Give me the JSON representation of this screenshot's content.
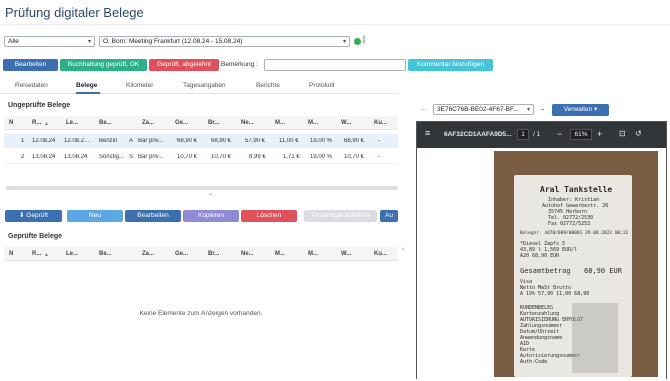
{
  "title": "Prüfung digitaler Belege",
  "filter": {
    "scope": "Alle",
    "trip": "O. Born: Meeting Frankfurt (12.08.24 - 15.08.24)"
  },
  "actions": {
    "edit": "Bearbeiten",
    "bookkeeping_ok": "Buchhaltung geprüft, OK",
    "rejected": "Geprüft, abgelehnt",
    "remark_label": "Bemerkung :",
    "remark_value": "",
    "add_comment": "Kommentar hinzufügen"
  },
  "tabs": [
    "Reisedaten",
    "Belege",
    "Kilometer",
    "Tagesangaben",
    "Berichte",
    "Protokoll"
  ],
  "unchecked": {
    "title": "Ungeprüfte Belege",
    "columns": [
      "N",
      "R...",
      "Le...",
      "Be...",
      "Za...",
      "Ge...",
      "Br...",
      "Ne...",
      "M...",
      "M...",
      "W...",
      "Ku..."
    ],
    "rows": [
      [
        "1",
        "12.08.24",
        "12.08.2...",
        "Benzin",
        "A",
        "Bar priv...",
        "68,90 €",
        "68,90 €",
        "57,90 €",
        "11,00 €",
        "19,00 %",
        "68,90 €",
        "-"
      ],
      [
        "2",
        "13.08.24",
        "13.08.24",
        "Sonstig...",
        "S",
        "Bar priv...",
        "10,70 €",
        "10,70 €",
        "8,99 €",
        "1,71 €",
        "19,00 %",
        "10,70 €",
        "-"
      ]
    ]
  },
  "buttons2": {
    "checked": "Geprüft",
    "new": "Neu",
    "edit": "Bearbeiten",
    "copy": "Kopieren",
    "delete": "Löschen",
    "split": "Prozentual aufteilen",
    "more": "Au"
  },
  "checked": {
    "title": "Geprüfte Belege",
    "columns": [
      "N",
      "R...",
      "Le...",
      "Be...",
      "Za...",
      "Ge...",
      "Br...",
      "Ne...",
      "M...",
      "M...",
      "W...",
      "Ku..."
    ],
    "empty": "Keine Elemente zum Anzeigen vorhanden."
  },
  "doc": {
    "id": "3E76C76B-BE02-4F67-BF...",
    "manage": "Verwalten",
    "file": "6AF32CD1AAFA9D5...",
    "page": "1",
    "pages": "/ 1",
    "zoom": "61%",
    "minus": "−",
    "plus": "+"
  },
  "receipt": {
    "header": "Aral Tankstelle",
    "lines": [
      "Inhaber: Kristian",
      "Autohof Gewerbestr. 26",
      "35745 Herborn",
      "Tel. 02772/2530",
      "Fax 02772/5253"
    ],
    "belegnr": "Belegnr. 4470/009/00001 29.08.2022 08:22",
    "items": [
      "*Diesel  Zapfs 5",
      "43,89 l  1,569 EUR/l",
      "A20 68,90 EUR"
    ],
    "total_label": "Gesamtbetrag",
    "total_value": "68,90 EUR",
    "tax": [
      "Visa",
      "Netto  MwSt   Brutto",
      "A 19%  57,90  11,00  68,90"
    ],
    "bottom": [
      "KUNDENBELEG",
      "Kartenzahlung",
      "AUTORISIERUNG ERFOLGT",
      "Zahlungsnummer",
      "Datum/Uhrzeit",
      "Anwendungsname",
      "AID",
      "Karte",
      "Autorisierungsnummer",
      "Auth-Code"
    ]
  },
  "colors": {
    "primary": "#3b6fb0",
    "green": "#2bb08a",
    "red": "#e0505a",
    "cyan": "#45c4d8"
  }
}
